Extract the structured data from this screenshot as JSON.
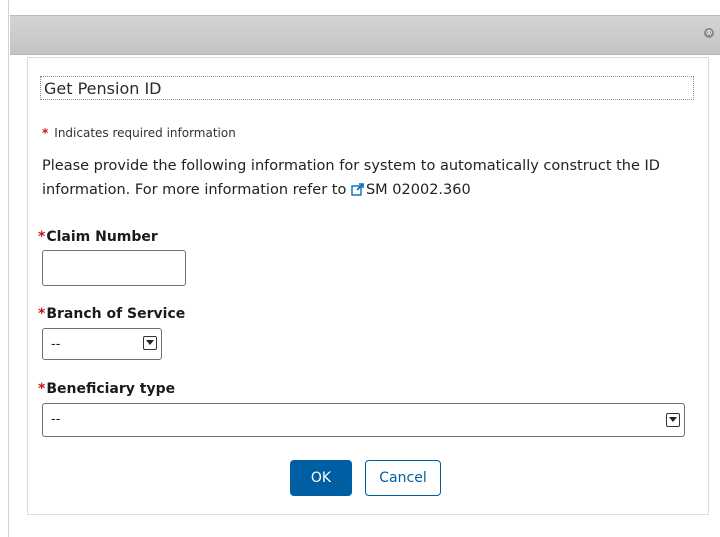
{
  "dialog": {
    "title": "Get Pension ID",
    "close_glyph": "⊗",
    "required_marker": "*",
    "required_note": "Indicates required information",
    "instructions_text": "Please provide the following information for system to automatically construct the ID information. For more information refer to ",
    "reference_link": "SM 02002.360",
    "reference_icon": "external-link-icon"
  },
  "form": {
    "claim_number": {
      "label": "Claim Number",
      "value": ""
    },
    "branch_of_service": {
      "label": "Branch of Service",
      "selected": "--"
    },
    "beneficiary_type": {
      "label": "Beneficiary type",
      "selected": "--"
    }
  },
  "buttons": {
    "ok": "OK",
    "cancel": "Cancel"
  },
  "colors": {
    "primary": "#005ea2",
    "required": "#c4161c",
    "titlebar": "#cccccc"
  }
}
